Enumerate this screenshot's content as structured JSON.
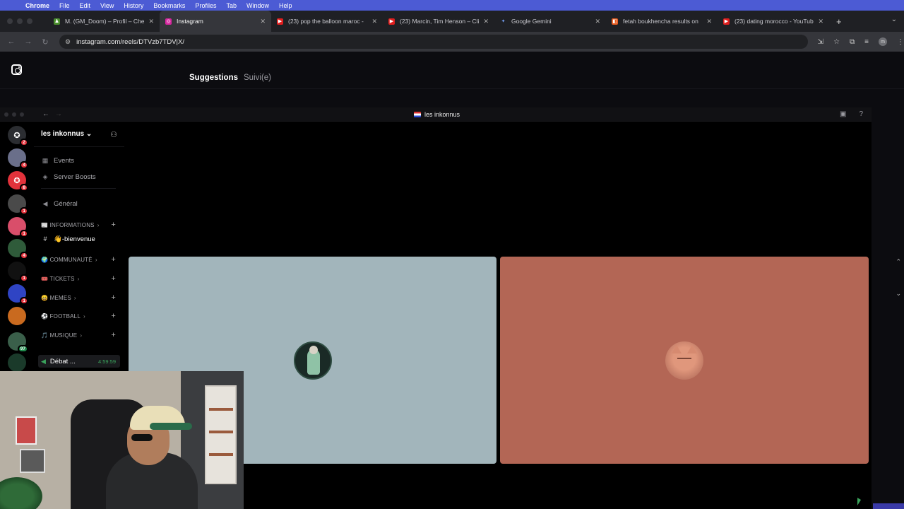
{
  "menubar": {
    "app": "Chrome",
    "items": [
      "File",
      "Edit",
      "View",
      "History",
      "Bookmarks",
      "Profiles",
      "Tab",
      "Window",
      "Help"
    ]
  },
  "tabs": [
    {
      "label": "M. (GM_Doom) – Profil – Che",
      "icon": "chess-icon",
      "color": "#4b8f2e",
      "active": false
    },
    {
      "label": "Instagram",
      "icon": "instagram-icon",
      "color": "#d6249f",
      "active": true
    },
    {
      "label": "(23) pop the balloon maroc -",
      "icon": "youtube-icon",
      "color": "#ff0000",
      "active": false
    },
    {
      "label": "(23) Marcin, Tim Henson – Cli",
      "icon": "youtube-icon",
      "color": "#ff0000",
      "active": false
    },
    {
      "label": "Google Gemini",
      "icon": "gemini-icon",
      "color": "#4f8cf6",
      "active": false
    },
    {
      "label": "fetah boukhencha results on",
      "icon": "app-icon",
      "color": "#e85a1e",
      "active": false
    },
    {
      "label": "(23) dating morocco - YouTub",
      "icon": "youtube-icon",
      "color": "#ff0000",
      "active": false
    }
  ],
  "address": {
    "url": "instagram.com/reels/DTVzb7TDV|X/"
  },
  "instagram": {
    "tab_suggestions": "Suggestions",
    "tab_following": "Suivi(e)"
  },
  "discord": {
    "window_title": "les inkonnus",
    "server_name": "les inkonnus",
    "server_name_chevron": "⌄",
    "channels": [
      {
        "label": "Events",
        "icon": "calendar-icon",
        "glyph": "▦",
        "kind": "item"
      },
      {
        "label": "Server Boosts",
        "icon": "boost-icon",
        "glyph": "◈",
        "kind": "item"
      },
      {
        "label": "Général",
        "icon": "speaker-icon",
        "glyph": "◀)",
        "kind": "item"
      },
      {
        "label": "📰 INFORMATIONS",
        "kind": "cat"
      },
      {
        "label": "👋-bienvenue",
        "icon": "hash-icon",
        "glyph": "#",
        "kind": "sel"
      },
      {
        "label": "🌍 COMMUNAUTÉ",
        "kind": "cat"
      },
      {
        "label": "🎟️ TICKETS",
        "kind": "cat"
      },
      {
        "label": "😄 MEMES",
        "kind": "cat"
      },
      {
        "label": "⚽ FOOTBALL",
        "kind": "cat"
      },
      {
        "label": "🎵 MUSIQUE",
        "kind": "cat"
      }
    ],
    "voice": {
      "label": "Débat ...",
      "timer": "4:59:59"
    },
    "rail_badges": [
      "2",
      "4",
      "8",
      "1",
      "1",
      "4",
      "1",
      "1",
      "97"
    ],
    "tile_left_color": "#a2b5bb",
    "tile_right_color": "#b36655"
  }
}
